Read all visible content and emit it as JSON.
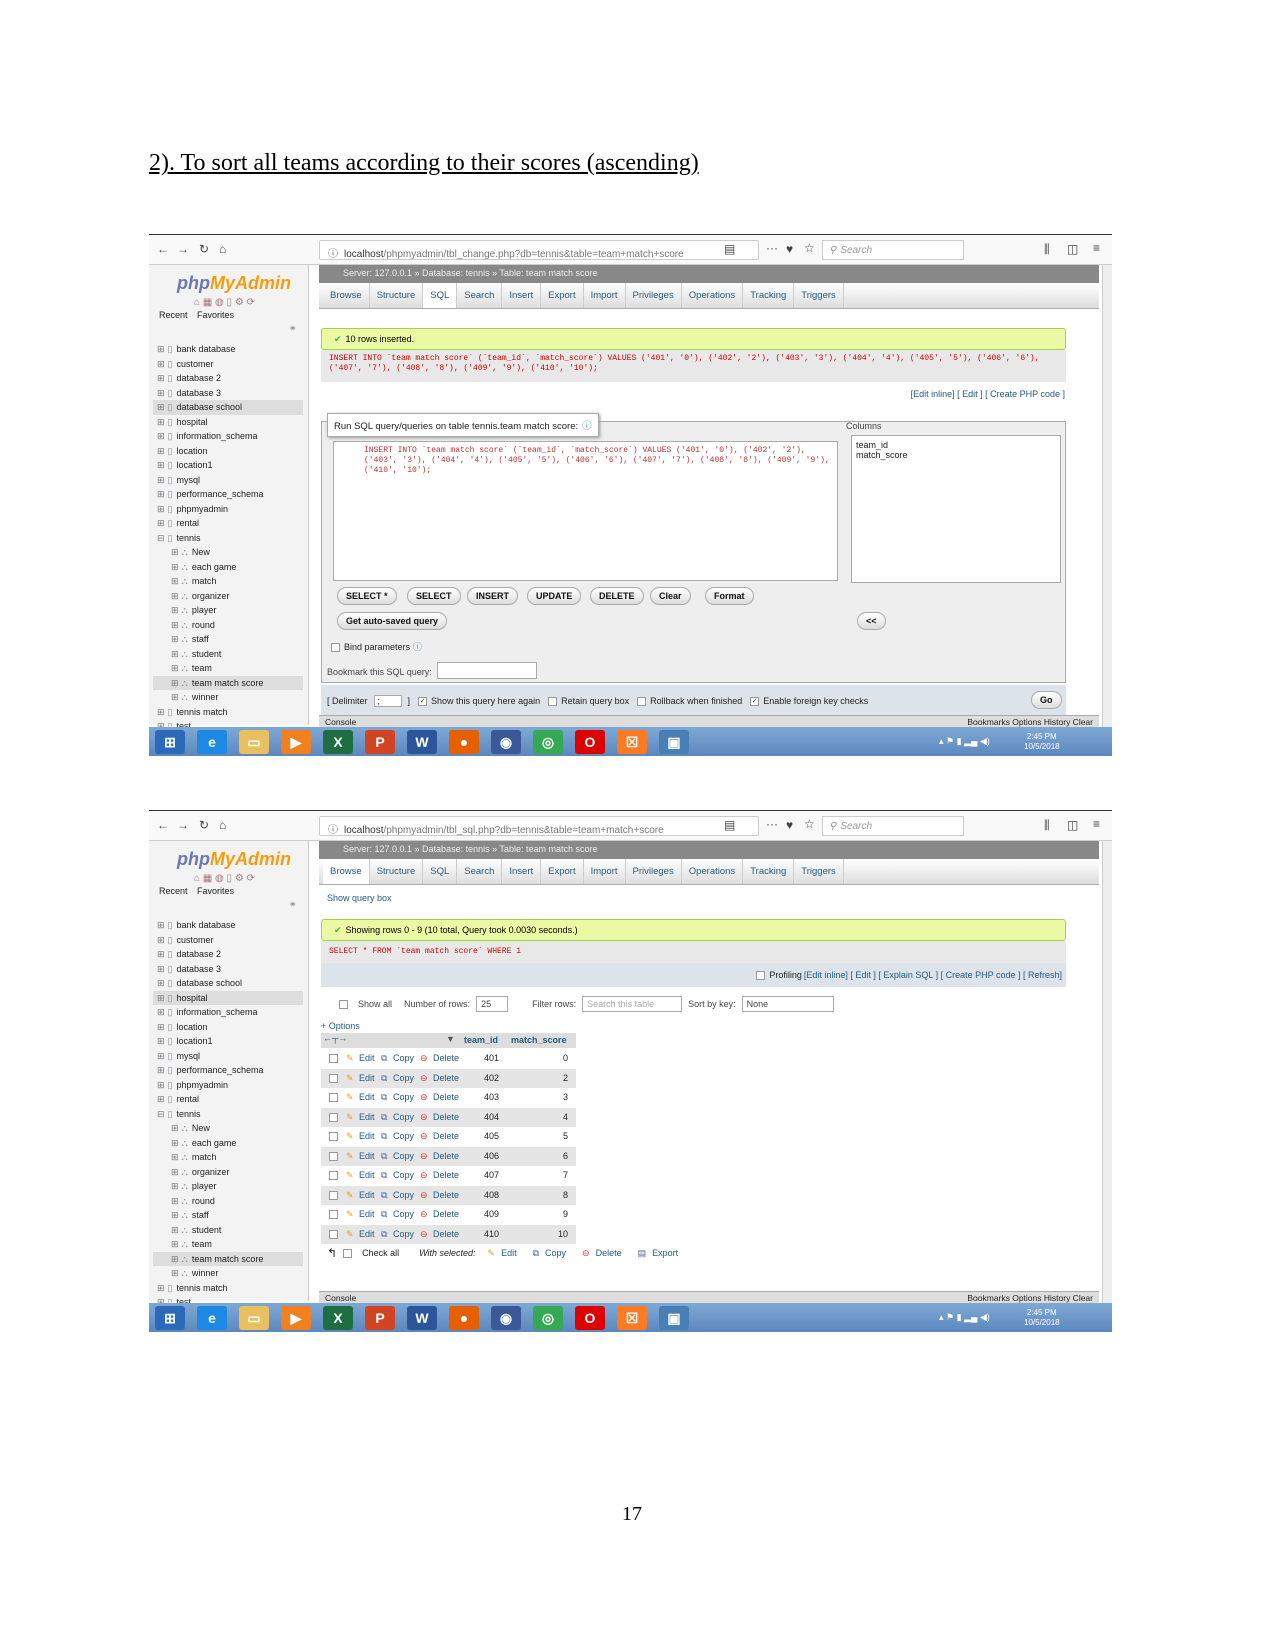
{
  "document": {
    "heading": "2). To sort all teams according to their scores (ascending)",
    "page_number": "17"
  },
  "colors": {
    "success_bg": "#ebf8a4",
    "link": "#235a81",
    "taskbar": "#6b96c9",
    "logo_php": "#6c78af",
    "logo_admin": "#f89c0e"
  },
  "shots": [
    {
      "browser": {
        "url_host": "localhost",
        "url_path": "/phpmyadmin/tbl_change.php?db=tennis&table=team+match+score",
        "search_placeholder": "Search"
      },
      "sidebar": {
        "logo_php": "php",
        "logo_admin": "MyAdmin",
        "tab_recent": "Recent",
        "tab_favorites": "Favorites",
        "items": [
          "bank database",
          "customer",
          "database 2",
          "database 3",
          "database school",
          "hospital",
          "information_schema",
          "location",
          "location1",
          "mysql",
          "performance_schema",
          "phpmyadmin",
          "rental",
          "tennis",
          "New",
          "each game",
          "match",
          "organizer",
          "player",
          "round",
          "staff",
          "student",
          "team",
          "team match score",
          "winner",
          "tennis match",
          "test"
        ],
        "highlighted": [
          "database school",
          "team match score"
        ]
      },
      "breadcrumb": "Server: 127.0.0.1 » Database: tennis » Table: team match score",
      "tabs": [
        "Browse",
        "Structure",
        "SQL",
        "Search",
        "Insert",
        "Export",
        "Import",
        "Privileges",
        "Operations",
        "Tracking",
        "Triggers"
      ],
      "active_tab": "SQL",
      "message": "10 rows inserted.",
      "sql": "INSERT INTO `team match score` (`team_id`, `match_score`) VALUES ('401', '0'), ('402', '2'), ('403', '3'), ('404', '4'), ('405', '5'), ('406', '6'),",
      "sql2": "('407', '7'), ('408', '8'), ('409', '9'), ('410', '10');",
      "links": "[Edit inline] [ Edit ] [ Create PHP code ]",
      "query_legend": "Run SQL query/queries on table tennis.team match score:",
      "editor_lines": [
        "INSERT INTO `team match score` (`team_id`, `match_score`) VALUES ('401', '0'), ('402', '2'),",
        "('403', '3'), ('404', '4'), ('405', '5'), ('406', '6'), ('407', '7'), ('408', '8'), ('409', '9'),",
        "('410', '10');"
      ],
      "columns_label": "Columns",
      "columns": [
        "team_id",
        "match_score"
      ],
      "buttons": [
        "SELECT *",
        "SELECT",
        "INSERT",
        "UPDATE",
        "DELETE",
        "Clear",
        "Format"
      ],
      "insert_col": "<<",
      "autosave": "Get auto-saved query",
      "bind_params": "Bind parameters",
      "bookmark_label": "Bookmark this SQL query:",
      "delimiter_label": "[ Delimiter",
      "delimiter_value": ";",
      "delimiter_close": "]",
      "options": [
        {
          "label": "Show this query here again",
          "checked": true
        },
        {
          "label": "Retain query box",
          "checked": false
        },
        {
          "label": "Rollback when finished",
          "checked": false
        },
        {
          "label": "Enable foreign key checks",
          "checked": true
        }
      ],
      "go": "Go",
      "console": "Console",
      "console_links": "Bookmarks  Options  History  Clear",
      "clock": {
        "time": "2:45 PM",
        "date": "10/5/2018"
      }
    },
    {
      "browser": {
        "url_host": "localhost",
        "url_path": "/phpmyadmin/tbl_sql.php?db=tennis&table=team+match+score",
        "search_placeholder": "Search"
      },
      "sidebar": {
        "logo_php": "php",
        "logo_admin": "MyAdmin",
        "tab_recent": "Recent",
        "tab_favorites": "Favorites",
        "items": [
          "bank database",
          "customer",
          "database 2",
          "database 3",
          "database school",
          "hospital",
          "information_schema",
          "location",
          "location1",
          "mysql",
          "performance_schema",
          "phpmyadmin",
          "rental",
          "tennis",
          "New",
          "each game",
          "match",
          "organizer",
          "player",
          "round",
          "staff",
          "student",
          "team",
          "team match score",
          "winner",
          "tennis match",
          "test"
        ],
        "highlighted": [
          "hospital",
          "team match score"
        ]
      },
      "breadcrumb": "Server: 127.0.0.1 » Database: tennis » Table: team match score",
      "tabs": [
        "Browse",
        "Structure",
        "SQL",
        "Search",
        "Insert",
        "Export",
        "Import",
        "Privileges",
        "Operations",
        "Tracking",
        "Triggers"
      ],
      "active_tab": "Browse",
      "show_query_box": "Show query box",
      "message": "Showing rows 0 - 9 (10 total, Query took 0.0030 seconds.)",
      "sql": "SELECT * FROM `team match score` WHERE 1",
      "profiling": "Profiling",
      "links": "[Edit inline] [ Edit ] [ Explain SQL ] [ Create PHP code ] [ Refresh]",
      "filter": {
        "show_all": "Show all",
        "num_rows_label": "Number of rows:",
        "num_rows": "25",
        "filter_label": "Filter rows:",
        "filter_placeholder": "Search this table",
        "sort_label": "Sort by key:",
        "sort_value": "None"
      },
      "options_link": "+ Options",
      "table": {
        "columns": [
          "team_id",
          "match_score"
        ],
        "row_actions": [
          "Edit",
          "Copy",
          "Delete"
        ],
        "rows": [
          [
            "401",
            "0"
          ],
          [
            "402",
            "2"
          ],
          [
            "403",
            "3"
          ],
          [
            "404",
            "4"
          ],
          [
            "405",
            "5"
          ],
          [
            "406",
            "6"
          ],
          [
            "407",
            "7"
          ],
          [
            "408",
            "8"
          ],
          [
            "409",
            "9"
          ],
          [
            "410",
            "10"
          ]
        ]
      },
      "bulk": {
        "check_all": "Check all",
        "with_selected": "With selected:",
        "actions": [
          "Edit",
          "Copy",
          "Delete",
          "Export"
        ]
      },
      "console": "Console",
      "console_links": "Bookmarks  Options  History  Clear",
      "clock": {
        "time": "2:45 PM",
        "date": "10/5/2018"
      }
    }
  ]
}
